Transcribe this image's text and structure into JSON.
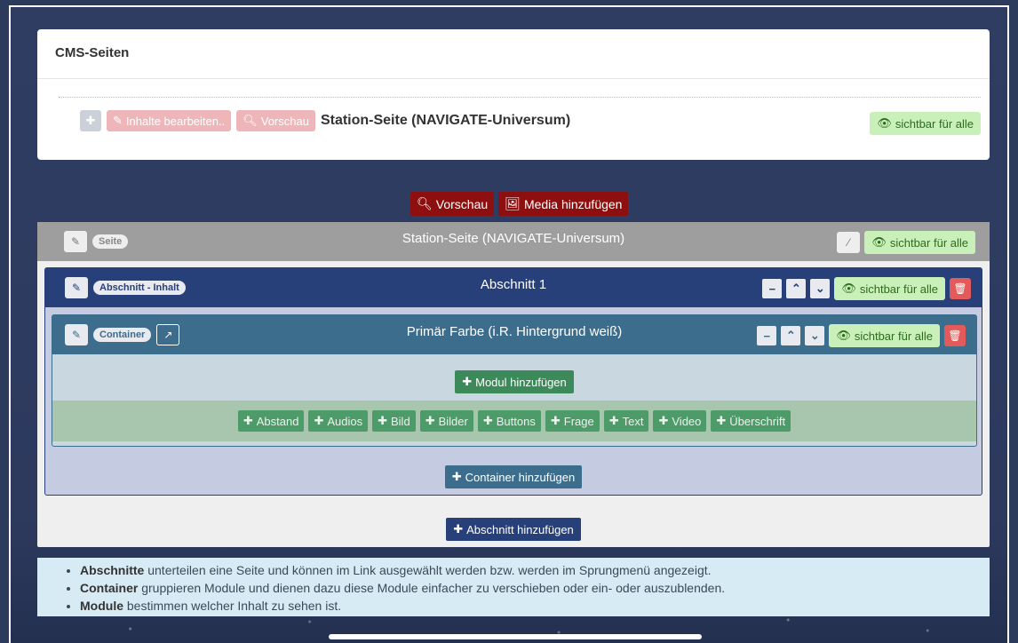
{
  "cms": {
    "header": "CMS-Seiten",
    "row": {
      "edit_label": "Inhalte bearbeiten..",
      "preview_label": "Vorschau",
      "title": "Station-Seite (NAVIGATE-Universum)",
      "visibility": "sichtbar für alle"
    }
  },
  "actions": {
    "preview": "Vorschau",
    "add_media": "Media hinzufügen"
  },
  "page": {
    "tag": "Seite",
    "title": "Station-Seite (NAVIGATE-Universum)",
    "visibility": "sichtbar für alle"
  },
  "section": {
    "tag": "Abschnitt - Inhalt",
    "title": "Abschnitt 1",
    "visibility": "sichtbar für alle"
  },
  "container": {
    "tag": "Container",
    "title": "Primär Farbe (i.R. Hintergrund weiß)",
    "visibility": "sichtbar für alle",
    "add_module": "Modul hinzufügen",
    "modules": [
      "Abstand",
      "Audios",
      "Bild",
      "Bilder",
      "Buttons",
      "Frage",
      "Text",
      "Video",
      "Überschrift"
    ]
  },
  "add_container": "Container hinzufügen",
  "add_section": "Abschnitt hinzufügen",
  "info": [
    {
      "bold": "Abschnitte",
      "text": " unterteilen eine Seite und können im Link ausgewählt werden bzw. werden im Sprungmenü angezeigt."
    },
    {
      "bold": "Container",
      "text": " gruppieren Module und dienen dazu diese Module einfacher zu verschieben oder ein- oder auszublenden."
    },
    {
      "bold": "Module",
      "text": " bestimmen welcher Inhalt zu sehen ist."
    }
  ],
  "colors": {
    "background": "#2c3a5c",
    "section": "#27407a",
    "container": "#3c6d8c",
    "green": "#3c8a5a",
    "red": "#8e0f0f",
    "visible_badge": "#c9f0b8"
  }
}
